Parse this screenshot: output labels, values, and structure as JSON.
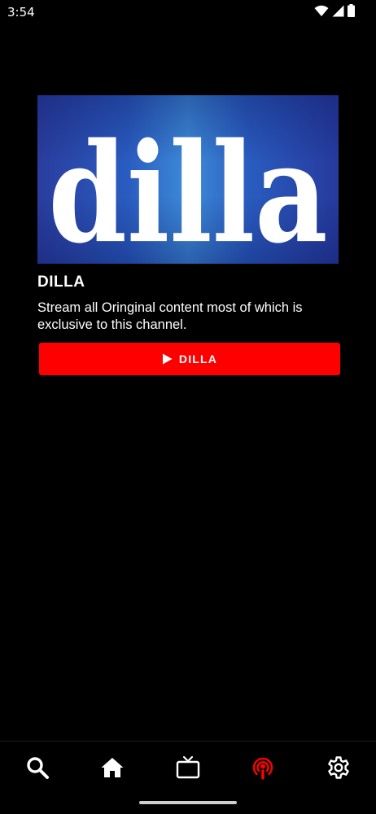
{
  "status_bar": {
    "time": "3:54",
    "icons": [
      "wifi-icon",
      "signal-icon",
      "battery-icon"
    ]
  },
  "channel": {
    "logo_text": "dilla",
    "title": "DILLA",
    "description": "Stream all Oringinal content most of which is exclusive to this channel.",
    "play_label": "DILLA",
    "play_icon": "play-icon"
  },
  "bottom_nav": {
    "items": [
      {
        "name": "search",
        "icon": "search-icon",
        "active": false
      },
      {
        "name": "home",
        "icon": "home-icon",
        "active": false
      },
      {
        "name": "tv",
        "icon": "tv-icon",
        "active": false
      },
      {
        "name": "live",
        "icon": "podcast-icon",
        "active": true
      },
      {
        "name": "settings",
        "icon": "gear-icon",
        "active": false
      }
    ]
  },
  "colors": {
    "background": "#000000",
    "accent": "#ff0000",
    "text": "#ffffff",
    "banner_blue": "#2a5cc0"
  }
}
